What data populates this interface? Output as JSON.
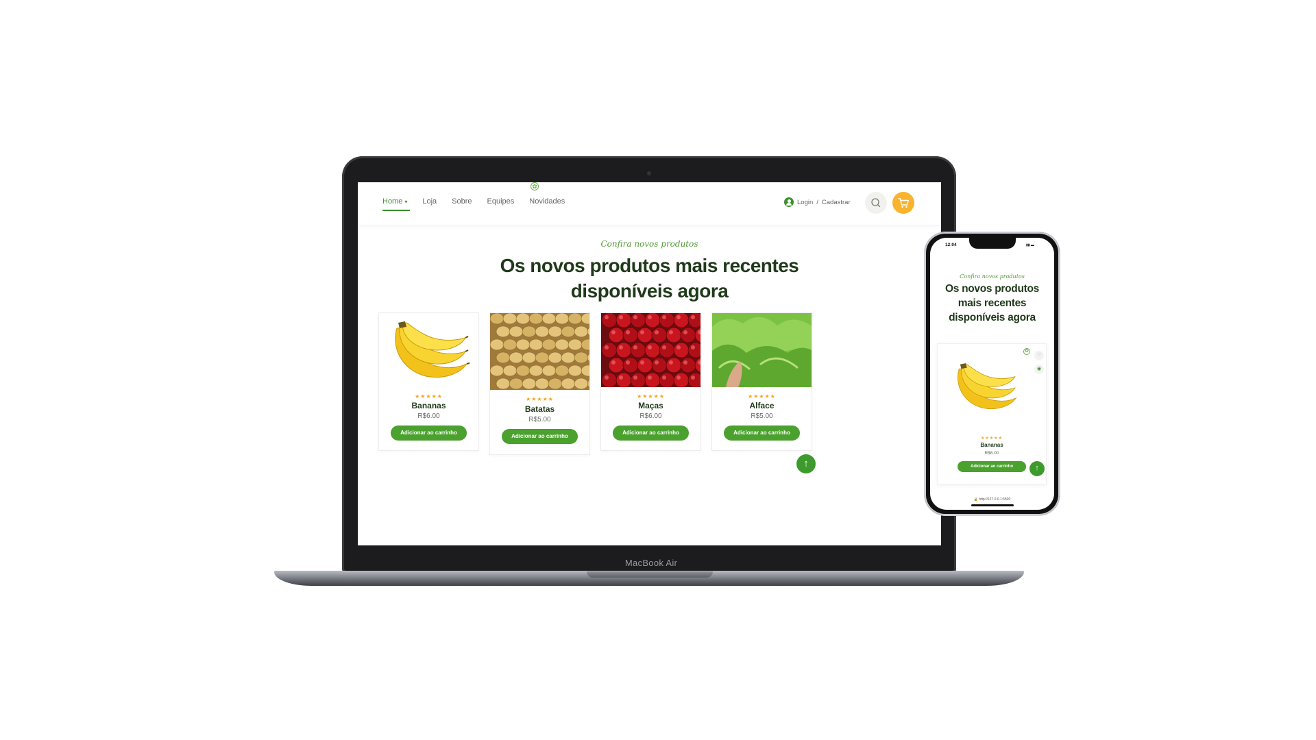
{
  "laptop": {
    "model_label": "MacBook Air"
  },
  "desktop_site": {
    "nav": {
      "links": [
        {
          "label": "Home",
          "active": true
        },
        {
          "label": "Loja"
        },
        {
          "label": "Sobre"
        },
        {
          "label": "Equipes"
        },
        {
          "label": "Novidades"
        }
      ],
      "login_label": "Login",
      "separator": "/",
      "register_label": "Cadastrar",
      "icons": {
        "user": "user-icon",
        "search": "search-icon",
        "cart": "cart-icon",
        "chevron": "chevron-down-icon"
      }
    },
    "section": {
      "subtitle": "Confira novos produtos",
      "headline_line1": "Os novos produtos mais recentes",
      "headline_line2": "disponíveis agora"
    },
    "products": [
      {
        "name": "Bananas",
        "price": "R$6.00",
        "rating": 5,
        "button": "Adicionar ao carrinho"
      },
      {
        "name": "Batatas",
        "price": "R$5.00",
        "rating": 5,
        "button": "Adicionar ao carrinho"
      },
      {
        "name": "Maças",
        "price": "R$6.00",
        "rating": 5,
        "button": "Adicionar ao carrinho"
      },
      {
        "name": "Alface",
        "price": "R$5.00",
        "rating": 5,
        "button": "Adicionar ao carrinho"
      }
    ],
    "scroll_top_icon": "arrow-up-icon",
    "colors": {
      "primary_green": "#4ba12e",
      "dark_green": "#1f3a1a",
      "accent_yellow": "#f9b32d",
      "star": "#f4a416"
    }
  },
  "phone": {
    "status_time": "12:04",
    "section": {
      "subtitle": "Confira novos produtos",
      "headline": "Os novos produtos mais recentes disponíveis agora"
    },
    "product": {
      "name": "Bananas",
      "price": "R$6.00",
      "rating": 5,
      "button": "Adicionar ao carrinho"
    },
    "url_bar": "http://127.0.0.1:5500"
  }
}
